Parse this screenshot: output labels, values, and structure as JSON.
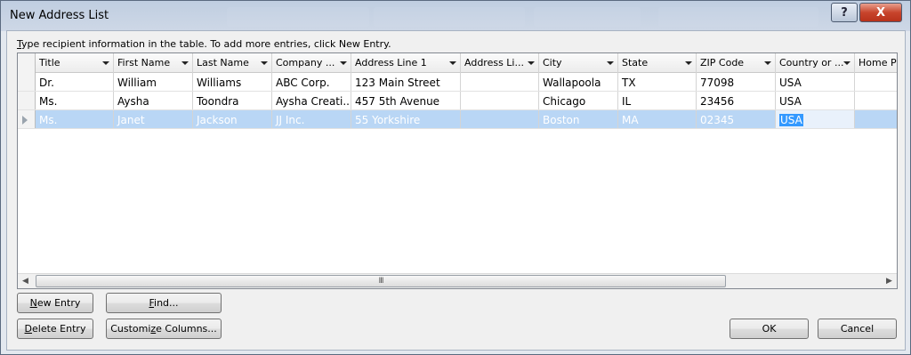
{
  "window": {
    "title": "New Address List"
  },
  "titlebar": {
    "help_glyph": "?",
    "close_glyph": "X"
  },
  "instruction": {
    "accel": "T",
    "text": "ype recipient information in the table.  To add more entries, click New Entry."
  },
  "columns": [
    {
      "label": "Title"
    },
    {
      "label": "First Name"
    },
    {
      "label": "Last Name"
    },
    {
      "label": "Company ..."
    },
    {
      "label": "Address Line 1"
    },
    {
      "label": "Address Li..."
    },
    {
      "label": "City"
    },
    {
      "label": "State"
    },
    {
      "label": "ZIP Code"
    },
    {
      "label": "Country or ..."
    },
    {
      "label": "Home Ph"
    }
  ],
  "rows": [
    {
      "cells": [
        "Dr.",
        "William",
        "Williams",
        "ABC Corp.",
        "123 Main Street",
        "",
        "Wallapoola",
        "TX",
        "77098",
        "USA",
        ""
      ]
    },
    {
      "cells": [
        "Ms.",
        "Aysha",
        "Toondra",
        "Aysha Creati...",
        "457 5th Avenue",
        "",
        "Chicago",
        "IL",
        "23456",
        "USA",
        ""
      ]
    },
    {
      "cells": [
        "Ms.",
        "Janet",
        "Jackson",
        "JJ Inc.",
        "55 Yorkshire",
        "",
        "Boston",
        "MA",
        "02345",
        "USA",
        ""
      ]
    }
  ],
  "scrollbar": {
    "left_glyph": "◀",
    "right_glyph": "▶",
    "grip": "III"
  },
  "buttons": {
    "new_entry_accel": "N",
    "new_entry_rest": "ew Entry",
    "find_accel": "F",
    "find_rest": "ind...",
    "delete_entry_accel": "D",
    "delete_entry_rest": "elete Entry",
    "customize_pre": "Customi",
    "customize_accel": "z",
    "customize_rest": "e Columns...",
    "ok": "OK",
    "cancel": "Cancel"
  },
  "colors": {
    "selection": "#b9d6f5",
    "active_text_bg": "#3399ff",
    "close": "#c8452d"
  },
  "selection": {
    "selected_row": 2,
    "active_column": 9
  }
}
